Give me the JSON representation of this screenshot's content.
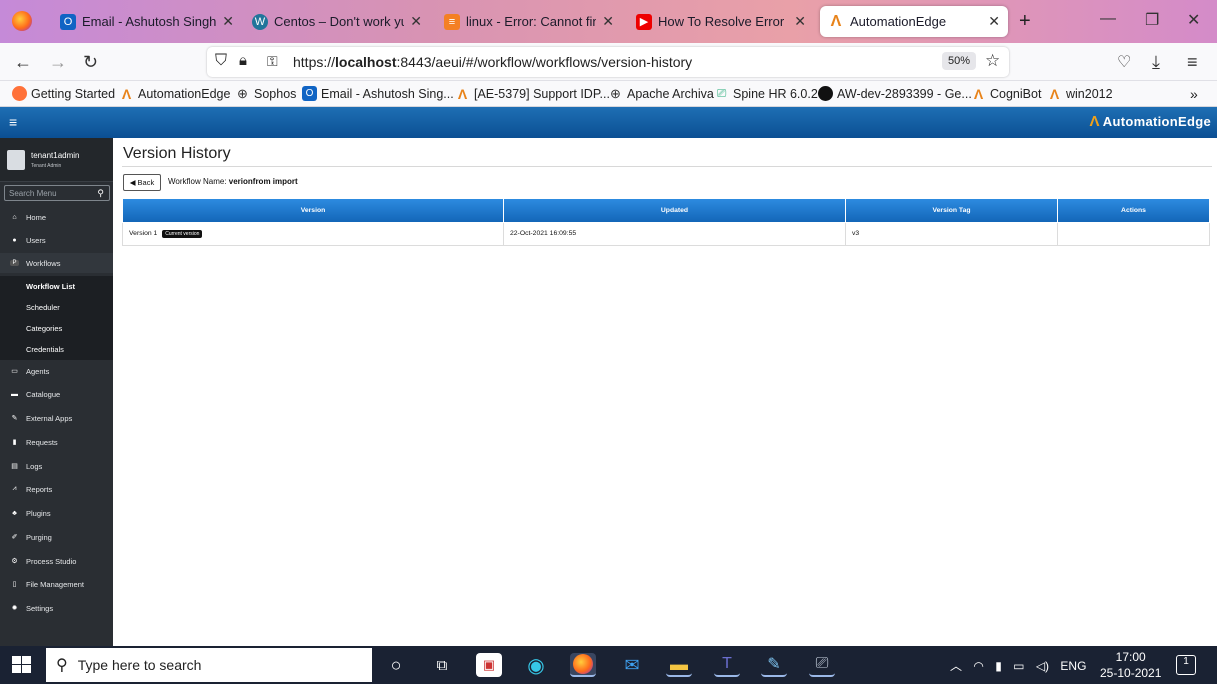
{
  "browser": {
    "tabs": [
      {
        "title": "Email - Ashutosh Singh - O",
        "icon": "outlook-icon",
        "color": "#1064c4"
      },
      {
        "title": "Centos – Don't work yum u",
        "icon": "wordpress-icon",
        "color": "#21759b"
      },
      {
        "title": "linux - Error: Cannot find a v",
        "icon": "stackoverflow-icon",
        "color": "#f48024"
      },
      {
        "title": "How To Resolve Error Canno",
        "icon": "youtube-icon",
        "color": "#e00"
      },
      {
        "title": "AutomationEdge",
        "icon": "automationedge-icon",
        "color": "#e8831a",
        "active": true
      }
    ],
    "url_prefix": "https://",
    "url_host": "localhost",
    "url_rest": ":8443/aeui/#/workflow/workflows/version-history",
    "zoom": "50%",
    "bookmarks": [
      {
        "label": "Getting Started",
        "icon": "firefox-icon",
        "color": "#ff7139"
      },
      {
        "label": "AutomationEdge",
        "icon": "automationedge-icon",
        "color": "#e8831a"
      },
      {
        "label": "Sophos",
        "icon": "globe-icon",
        "color": "#333"
      },
      {
        "label": "Email - Ashutosh Sing...",
        "icon": "outlook-icon",
        "color": "#1064c4"
      },
      {
        "label": "[AE-5379] Support IDP...",
        "icon": "automationedge-icon",
        "color": "#e8831a"
      },
      {
        "label": "Apache Archiva",
        "icon": "globe-icon",
        "color": "#333"
      },
      {
        "label": "Spine HR 6.0.2",
        "icon": "spine-icon",
        "color": "#2a7"
      },
      {
        "label": "AW-dev-2893399 - Ge...",
        "icon": "github-icon",
        "color": "#111"
      },
      {
        "label": "CogniBot",
        "icon": "automationedge-icon",
        "color": "#e8831a"
      },
      {
        "label": "win2012",
        "icon": "automationedge-icon",
        "color": "#e8831a"
      }
    ]
  },
  "app": {
    "brand": "AutomationEdge",
    "user": {
      "name": "tenant1admin",
      "role": "Tenant Admin"
    },
    "search_placeholder": "Search Menu",
    "menu": [
      {
        "label": "Home",
        "icon": "home-icon"
      },
      {
        "label": "Users",
        "icon": "users-icon"
      },
      {
        "label": "Workflows",
        "icon": "workflow-icon",
        "selected": true
      },
      {
        "label": "Agents",
        "icon": "monitor-icon"
      },
      {
        "label": "Catalogue",
        "icon": "catalogue-icon"
      },
      {
        "label": "External Apps",
        "icon": "external-apps-icon"
      },
      {
        "label": "Requests",
        "icon": "requests-icon"
      },
      {
        "label": "Logs",
        "icon": "logs-icon"
      },
      {
        "label": "Reports",
        "icon": "reports-icon"
      },
      {
        "label": "Plugins",
        "icon": "plugins-icon"
      },
      {
        "label": "Purging",
        "icon": "purging-icon"
      },
      {
        "label": "Process Studio",
        "icon": "process-studio-icon"
      },
      {
        "label": "File Management",
        "icon": "file-icon"
      },
      {
        "label": "Settings",
        "icon": "settings-icon"
      }
    ],
    "workflow_submenu": [
      "Workflow List",
      "Scheduler",
      "Categories",
      "Credentials"
    ],
    "page_title": "Version History",
    "back_label": "Back",
    "workflow_name_label": "Workflow Name:",
    "workflow_name": "verionfrom import",
    "table": {
      "headers": [
        "Version",
        "Updated",
        "Version Tag",
        "Actions"
      ],
      "rows": [
        {
          "version": "Version 1",
          "badge": "Current version",
          "updated": "22-Oct-2021 16:09:55",
          "tag": "v3",
          "actions": ""
        }
      ]
    }
  },
  "taskbar": {
    "search_placeholder": "Type here to search",
    "language": "ENG",
    "time": "17:00",
    "date": "25-10-2021",
    "notifications": "1"
  }
}
